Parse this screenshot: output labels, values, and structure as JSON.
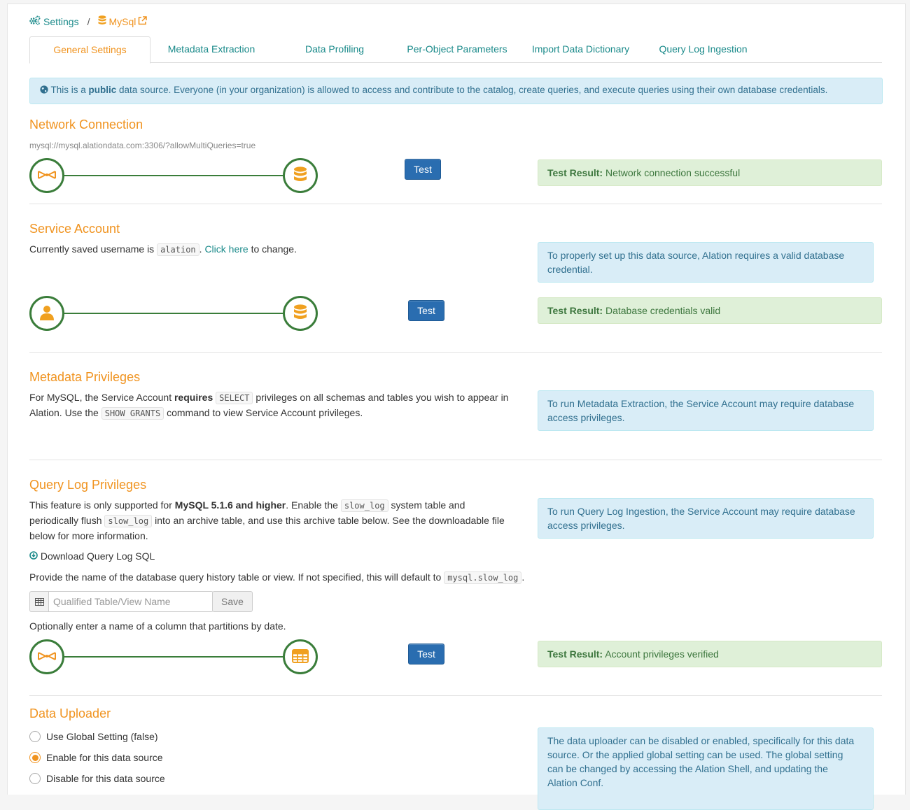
{
  "breadcrumb": {
    "settings": "Settings",
    "separator": "/",
    "source": "MySql"
  },
  "tabs": [
    {
      "label": "General Settings",
      "active": true
    },
    {
      "label": "Metadata Extraction"
    },
    {
      "label": "Data Profiling"
    },
    {
      "label": "Per-Object Parameters"
    },
    {
      "label": "Import Data Dictionary"
    },
    {
      "label": "Query Log Ingestion"
    }
  ],
  "public_notice": {
    "prefix": "This is a ",
    "bold": "public",
    "suffix": " data source. Everyone (in your organization) is allowed to access and contribute to the catalog, create queries, and execute queries using their own database credentials."
  },
  "network": {
    "title": "Network Connection",
    "uri": "mysql://mysql.alationdata.com:3306/?allowMultiQueries=true",
    "test_label": "Test",
    "result_label": "Test Result:",
    "result_text": " Network connection successful"
  },
  "service": {
    "title": "Service Account",
    "text_prefix": "Currently saved username is ",
    "username": "alation",
    "text_mid": ". ",
    "link": "Click here",
    "text_suffix": " to change.",
    "info": "To properly set up this data source, Alation requires a valid database credential.",
    "test_label": "Test",
    "result_label": "Test Result:",
    "result_text": " Database credentials valid"
  },
  "metadata": {
    "title": "Metadata Privileges",
    "t1": "For MySQL, the Service Account ",
    "t1b": "requires",
    "code1": "SELECT",
    "t2": " privileges on all schemas and tables you wish to appear in Alation. Use the ",
    "code2": "SHOW GRANTS",
    "t3": " command to view Service Account privileges.",
    "info": "To run Metadata Extraction, the Service Account may require database access privileges."
  },
  "querylog": {
    "title": "Query Log Privileges",
    "t1": "This feature is only supported for ",
    "t1b": "MySQL 5.1.6 and higher",
    "t2": ". Enable the ",
    "code1": "slow_log",
    "t3": " system table and periodically flush ",
    "code2": "slow_log",
    "t4": " into an archive table, and use this archive table below. See the downloadable file below for more information.",
    "download": "Download Query Log SQL",
    "provide": "Provide the name of the database query history table or view. If not specified, this will default to ",
    "default_code": "mysql.slow_log",
    "provide_end": ".",
    "input_placeholder": "Qualified Table/View Name",
    "save_label": "Save",
    "optional": "Optionally enter a name of a column that partitions by date.",
    "info": "To run Query Log Ingestion, the Service Account may require database access privileges.",
    "test_label": "Test",
    "result_label": "Test Result:",
    "result_text": " Account privileges verified"
  },
  "uploader": {
    "title": "Data Uploader",
    "options": [
      {
        "label": "Use Global Setting (false)",
        "checked": false
      },
      {
        "label": "Enable for this data source",
        "checked": true
      },
      {
        "label": "Disable for this data source",
        "checked": false
      }
    ],
    "info": "The data uploader can be disabled or enabled, specifically for this data source. Or the applied global setting can be used. The global setting can be changed by accessing the Alation Shell, and updating the Alation Conf."
  },
  "colors": {
    "teal": "#1a8a8a",
    "orange": "#f0931f",
    "green": "#3a7d3a",
    "blue": "#2a6db0"
  }
}
